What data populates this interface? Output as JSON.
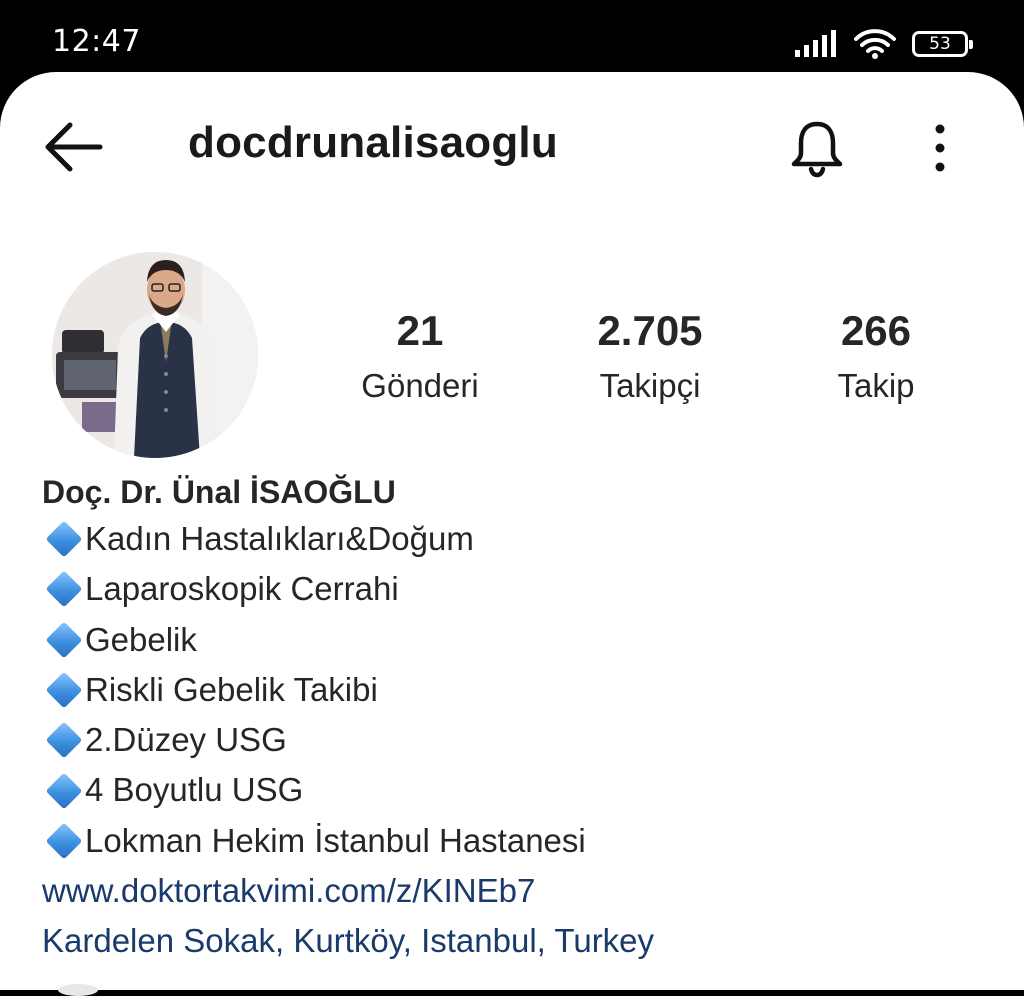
{
  "status_bar": {
    "time": "12:47",
    "battery": "53"
  },
  "header": {
    "username": "docdrunalisaoglu"
  },
  "stats": {
    "posts": {
      "value": "21",
      "label": "Gönderi"
    },
    "followers": {
      "value": "2.705",
      "label": "Takipçi"
    },
    "following": {
      "value": "266",
      "label": "Takip"
    }
  },
  "bio": {
    "name": "Doç. Dr. Ünal İSAOĞLU",
    "lines": [
      "Kadın Hastalıkları&Doğum",
      "Laparoskopik Cerrahi",
      "Gebelik",
      "Riskli Gebelik Takibi",
      "2.Düzey USG",
      "4 Boyutlu USG",
      "Lokman Hekim İstanbul Hastanesi"
    ],
    "link": "www.doktortakvimi.com/z/KINEb7",
    "location": "Kardelen Sokak, Kurtköy, Istanbul, Turkey"
  },
  "icons": {
    "back": "arrow-left-icon",
    "notifications": "bell-icon",
    "more": "vertical-dots-icon",
    "bullet": "blue-diamond-icon"
  }
}
